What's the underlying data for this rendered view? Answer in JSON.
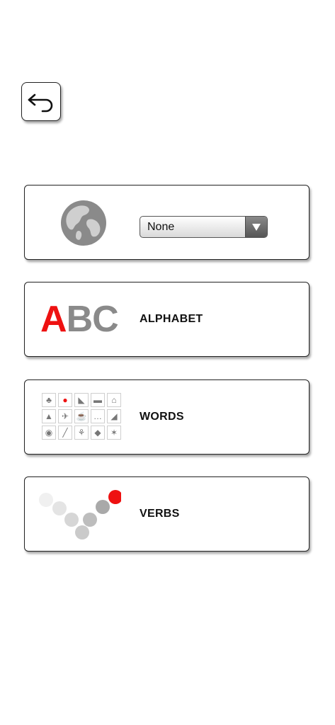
{
  "navigation": {
    "back_icon": "undo-arrow-icon"
  },
  "language_card": {
    "icon": "globe-icon",
    "select": {
      "selected_value": "None",
      "arrow_icon": "triangle-down-icon"
    }
  },
  "alphabet_card": {
    "logo": {
      "first_letter": "A",
      "rest_letters": "BC"
    },
    "label": "ALPHABET"
  },
  "words_card": {
    "icon_grid": [
      {
        "icon": "radish-icon",
        "glyph": "♣",
        "highlight": false
      },
      {
        "icon": "apple-icon",
        "glyph": "●",
        "highlight": true
      },
      {
        "icon": "shoe-icon",
        "glyph": "◣",
        "highlight": false
      },
      {
        "icon": "cow-icon",
        "glyph": "▬",
        "highlight": false
      },
      {
        "icon": "house-icon",
        "glyph": "⌂",
        "highlight": false
      },
      {
        "icon": "shapes-icon",
        "glyph": "▲",
        "highlight": false
      },
      {
        "icon": "runner-icon",
        "glyph": "✈",
        "highlight": false
      },
      {
        "icon": "cup-icon",
        "glyph": "☕",
        "highlight": false
      },
      {
        "icon": "dots-icon",
        "glyph": "…",
        "highlight": false
      },
      {
        "icon": "vacuum-icon",
        "glyph": "◢",
        "highlight": false
      },
      {
        "icon": "tractor-icon",
        "glyph": "◉",
        "highlight": false
      },
      {
        "icon": "carrot-icon",
        "glyph": "╱",
        "highlight": false
      },
      {
        "icon": "plant-icon",
        "glyph": "⚘",
        "highlight": false
      },
      {
        "icon": "beetle-icon",
        "glyph": "◆",
        "highlight": false
      },
      {
        "icon": "starfish-icon",
        "glyph": "✶",
        "highlight": false
      }
    ],
    "label": "WORDS"
  },
  "verbs_card": {
    "icon": "verbs-dots-icon",
    "label": "VERBS"
  },
  "colors": {
    "accent_red": "#ee1111",
    "icon_gray": "#8a8a8a",
    "border": "#222222"
  }
}
